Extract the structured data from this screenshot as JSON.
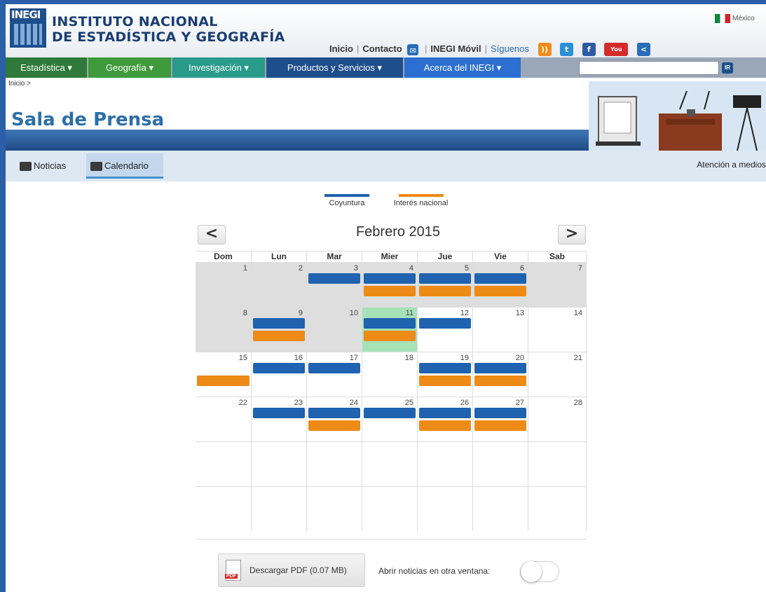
{
  "header": {
    "logo_text": "INEGI",
    "org_line1": "INSTITUTO NACIONAL",
    "org_line2": "DE ESTADÍSTICA Y GEOGRAFÍA",
    "links": [
      "Inicio",
      "Contacto",
      "INEGI Móvil",
      "Síguenos"
    ],
    "country": "México",
    "social_icons": [
      "rss-icon",
      "twitter-icon",
      "facebook-icon",
      "youtube-icon",
      "share-icon"
    ]
  },
  "nav": {
    "items": [
      {
        "label": "Estadística ▾",
        "color": "#2f7a3a"
      },
      {
        "label": "Geografía ▾",
        "color": "#3f9a3c"
      },
      {
        "label": "Investigación ▾",
        "color": "#2a9a8a"
      },
      {
        "label": "Productos y Servicios ▾",
        "color": "#1f4e8c"
      },
      {
        "label": "Acerca del INEGI ▾",
        "color": "#2c6fd0"
      }
    ],
    "search_placeholder": "",
    "search_button": "IR"
  },
  "breadcrumb": "Inicio >",
  "banner": {
    "title": "Sala de Prensa"
  },
  "subnav": {
    "tabs": [
      {
        "label": "Noticias",
        "active": false
      },
      {
        "label": "Calendario",
        "active": true
      }
    ],
    "right_link": "Atención a medios"
  },
  "legend": [
    {
      "label": "Coyuntura",
      "color": "#1f62b0"
    },
    {
      "label": "Interés nacional",
      "color": "#ee8a16"
    }
  ],
  "calendar": {
    "title": "Febrero 2015",
    "prev": "<",
    "next": ">",
    "weekdays": [
      "Dom",
      "Lun",
      "Mar",
      "Mier",
      "Jue",
      "Vie",
      "Sab"
    ],
    "weeks": [
      [
        {
          "d": "1",
          "g": true,
          "e": []
        },
        {
          "d": "2",
          "g": true,
          "e": []
        },
        {
          "d": "3",
          "g": true,
          "e": [
            "blue"
          ]
        },
        {
          "d": "4",
          "g": true,
          "e": [
            "blue",
            "orange"
          ]
        },
        {
          "d": "5",
          "g": true,
          "e": [
            "blue",
            "orange"
          ]
        },
        {
          "d": "6",
          "g": true,
          "e": [
            "blue",
            "orange"
          ]
        },
        {
          "d": "7",
          "g": true,
          "e": []
        }
      ],
      [
        {
          "d": "8",
          "g": true,
          "e": []
        },
        {
          "d": "9",
          "g": true,
          "e": [
            "blue",
            "orange"
          ]
        },
        {
          "d": "10",
          "g": true,
          "e": []
        },
        {
          "d": "11",
          "today": true,
          "e": [
            "blue",
            "orange"
          ]
        },
        {
          "d": "12",
          "e": [
            "blue"
          ]
        },
        {
          "d": "13",
          "e": []
        },
        {
          "d": "14",
          "e": []
        }
      ],
      [
        {
          "d": "15",
          "e": [
            "orange"
          ]
        },
        {
          "d": "16",
          "e": [
            "blue"
          ]
        },
        {
          "d": "17",
          "e": [
            "blue"
          ]
        },
        {
          "d": "18",
          "e": []
        },
        {
          "d": "19",
          "e": [
            "blue",
            "orange"
          ]
        },
        {
          "d": "20",
          "e": [
            "blue",
            "orange"
          ]
        },
        {
          "d": "21",
          "e": []
        }
      ],
      [
        {
          "d": "22",
          "e": []
        },
        {
          "d": "23",
          "e": [
            "blue"
          ]
        },
        {
          "d": "24",
          "e": [
            "blue",
            "orange"
          ]
        },
        {
          "d": "25",
          "e": [
            "blue"
          ]
        },
        {
          "d": "26",
          "e": [
            "blue",
            "orange"
          ]
        },
        {
          "d": "27",
          "e": [
            "blue",
            "orange"
          ]
        },
        {
          "d": "28",
          "e": []
        }
      ],
      [
        {
          "d": "",
          "e": []
        },
        {
          "d": "",
          "e": []
        },
        {
          "d": "",
          "e": []
        },
        {
          "d": "",
          "e": []
        },
        {
          "d": "",
          "e": []
        },
        {
          "d": "",
          "e": []
        },
        {
          "d": "",
          "e": []
        }
      ],
      [
        {
          "d": "",
          "e": []
        },
        {
          "d": "",
          "e": []
        },
        {
          "d": "",
          "e": []
        },
        {
          "d": "",
          "e": []
        },
        {
          "d": "",
          "e": []
        },
        {
          "d": "",
          "e": []
        },
        {
          "d": "",
          "e": []
        }
      ]
    ]
  },
  "footer": {
    "pdf_label": "Descargar PDF (0.07 MB)",
    "pdf_badge": "PDF",
    "new_window_label": "Abrir noticias en otra ventana:",
    "new_window_enabled": false
  }
}
